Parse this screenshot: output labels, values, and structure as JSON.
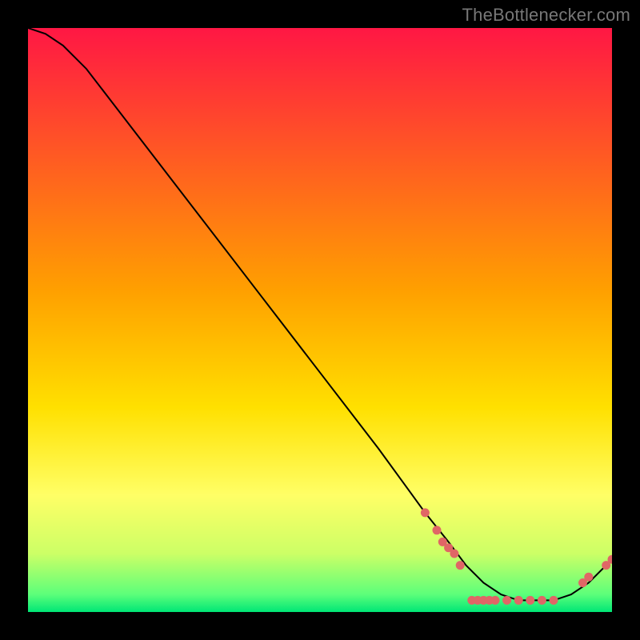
{
  "watermark": "TheBottlenecker.com",
  "chart_data": {
    "type": "line",
    "title": "",
    "xlabel": "",
    "ylabel": "",
    "xlim": [
      0,
      100
    ],
    "ylim": [
      0,
      100
    ],
    "grid": false,
    "legend": false,
    "gradient_stops": [
      {
        "pos": 0.0,
        "color": "#ff1744"
      },
      {
        "pos": 0.45,
        "color": "#ffa000"
      },
      {
        "pos": 0.65,
        "color": "#ffe000"
      },
      {
        "pos": 0.8,
        "color": "#ffff66"
      },
      {
        "pos": 0.9,
        "color": "#ccff66"
      },
      {
        "pos": 0.97,
        "color": "#5cff7a"
      },
      {
        "pos": 1.0,
        "color": "#00e676"
      }
    ],
    "series": [
      {
        "name": "bottleneck-curve",
        "x": [
          0,
          3,
          6,
          10,
          20,
          30,
          40,
          50,
          60,
          68,
          72,
          75,
          78,
          81,
          84,
          87,
          90,
          93,
          96,
          100
        ],
        "y": [
          100,
          99,
          97,
          93,
          80,
          67,
          54,
          41,
          28,
          17,
          12,
          8,
          5,
          3,
          2,
          2,
          2,
          3,
          5,
          9
        ]
      }
    ],
    "markers": [
      {
        "x": 68,
        "y": 17
      },
      {
        "x": 70,
        "y": 14
      },
      {
        "x": 71,
        "y": 12
      },
      {
        "x": 72,
        "y": 11
      },
      {
        "x": 73,
        "y": 10
      },
      {
        "x": 74,
        "y": 8
      },
      {
        "x": 76,
        "y": 2
      },
      {
        "x": 77,
        "y": 2
      },
      {
        "x": 78,
        "y": 2
      },
      {
        "x": 79,
        "y": 2
      },
      {
        "x": 80,
        "y": 2
      },
      {
        "x": 82,
        "y": 2
      },
      {
        "x": 84,
        "y": 2
      },
      {
        "x": 86,
        "y": 2
      },
      {
        "x": 88,
        "y": 2
      },
      {
        "x": 90,
        "y": 2
      },
      {
        "x": 95,
        "y": 5
      },
      {
        "x": 96,
        "y": 6
      },
      {
        "x": 99,
        "y": 8
      },
      {
        "x": 100,
        "y": 9
      }
    ],
    "marker_color": "#e06666",
    "line_color": "#000000"
  }
}
